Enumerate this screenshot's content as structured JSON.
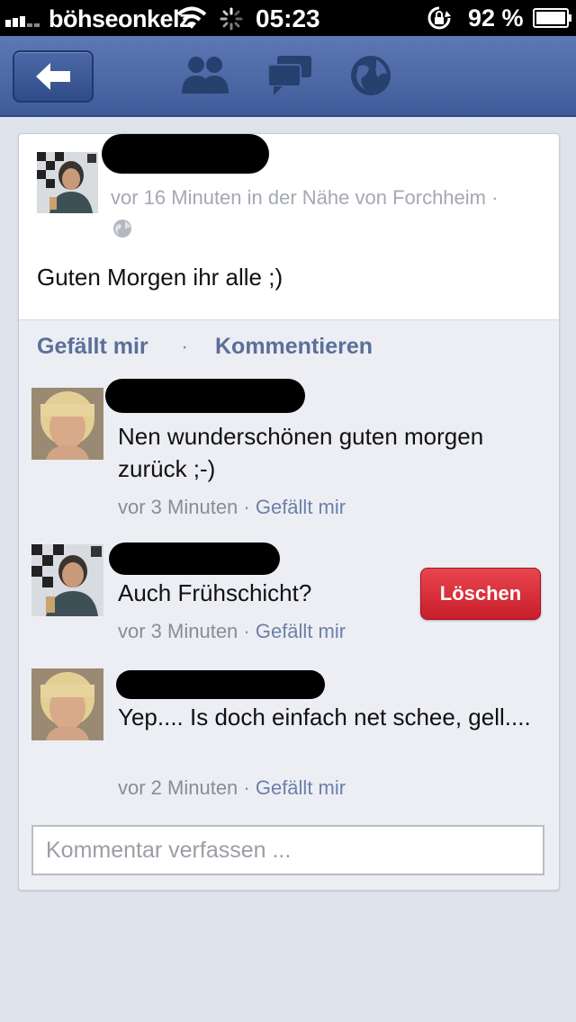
{
  "status_bar": {
    "carrier": "böhseonkelz",
    "time": "05:23",
    "battery": "92 %"
  },
  "navbar": {
    "back_icon": "back-arrow-icon",
    "icons": [
      "friends-icon",
      "messages-icon",
      "globe-icon"
    ]
  },
  "post": {
    "meta": "vor 16 Minuten in der Nähe von Forchheim ·",
    "privacy_icon": "globe-icon",
    "text": "Guten Morgen ihr alle ;)"
  },
  "actions": {
    "like": "Gefällt mir",
    "separator": "·",
    "comment": "Kommentieren"
  },
  "comments": [
    {
      "text": "Nen wunderschönen guten morgen zurück ;-)",
      "time": "vor 3 Minuten · ",
      "like": "Gefällt mir"
    },
    {
      "text": "Auch Frühschicht?",
      "time": "vor 3 Minuten · ",
      "like": "Gefällt mir",
      "delete_label": "Löschen"
    },
    {
      "text": "Yep.... Is doch einfach net schee, gell....",
      "time": "vor 2 Minuten · ",
      "like": "Gefällt mir"
    }
  ],
  "comment_input": {
    "placeholder": "Kommentar verfassen ..."
  },
  "colors": {
    "navbar": "#3f5c9a",
    "link": "#5b6f98",
    "delete": "#c81e2a"
  }
}
